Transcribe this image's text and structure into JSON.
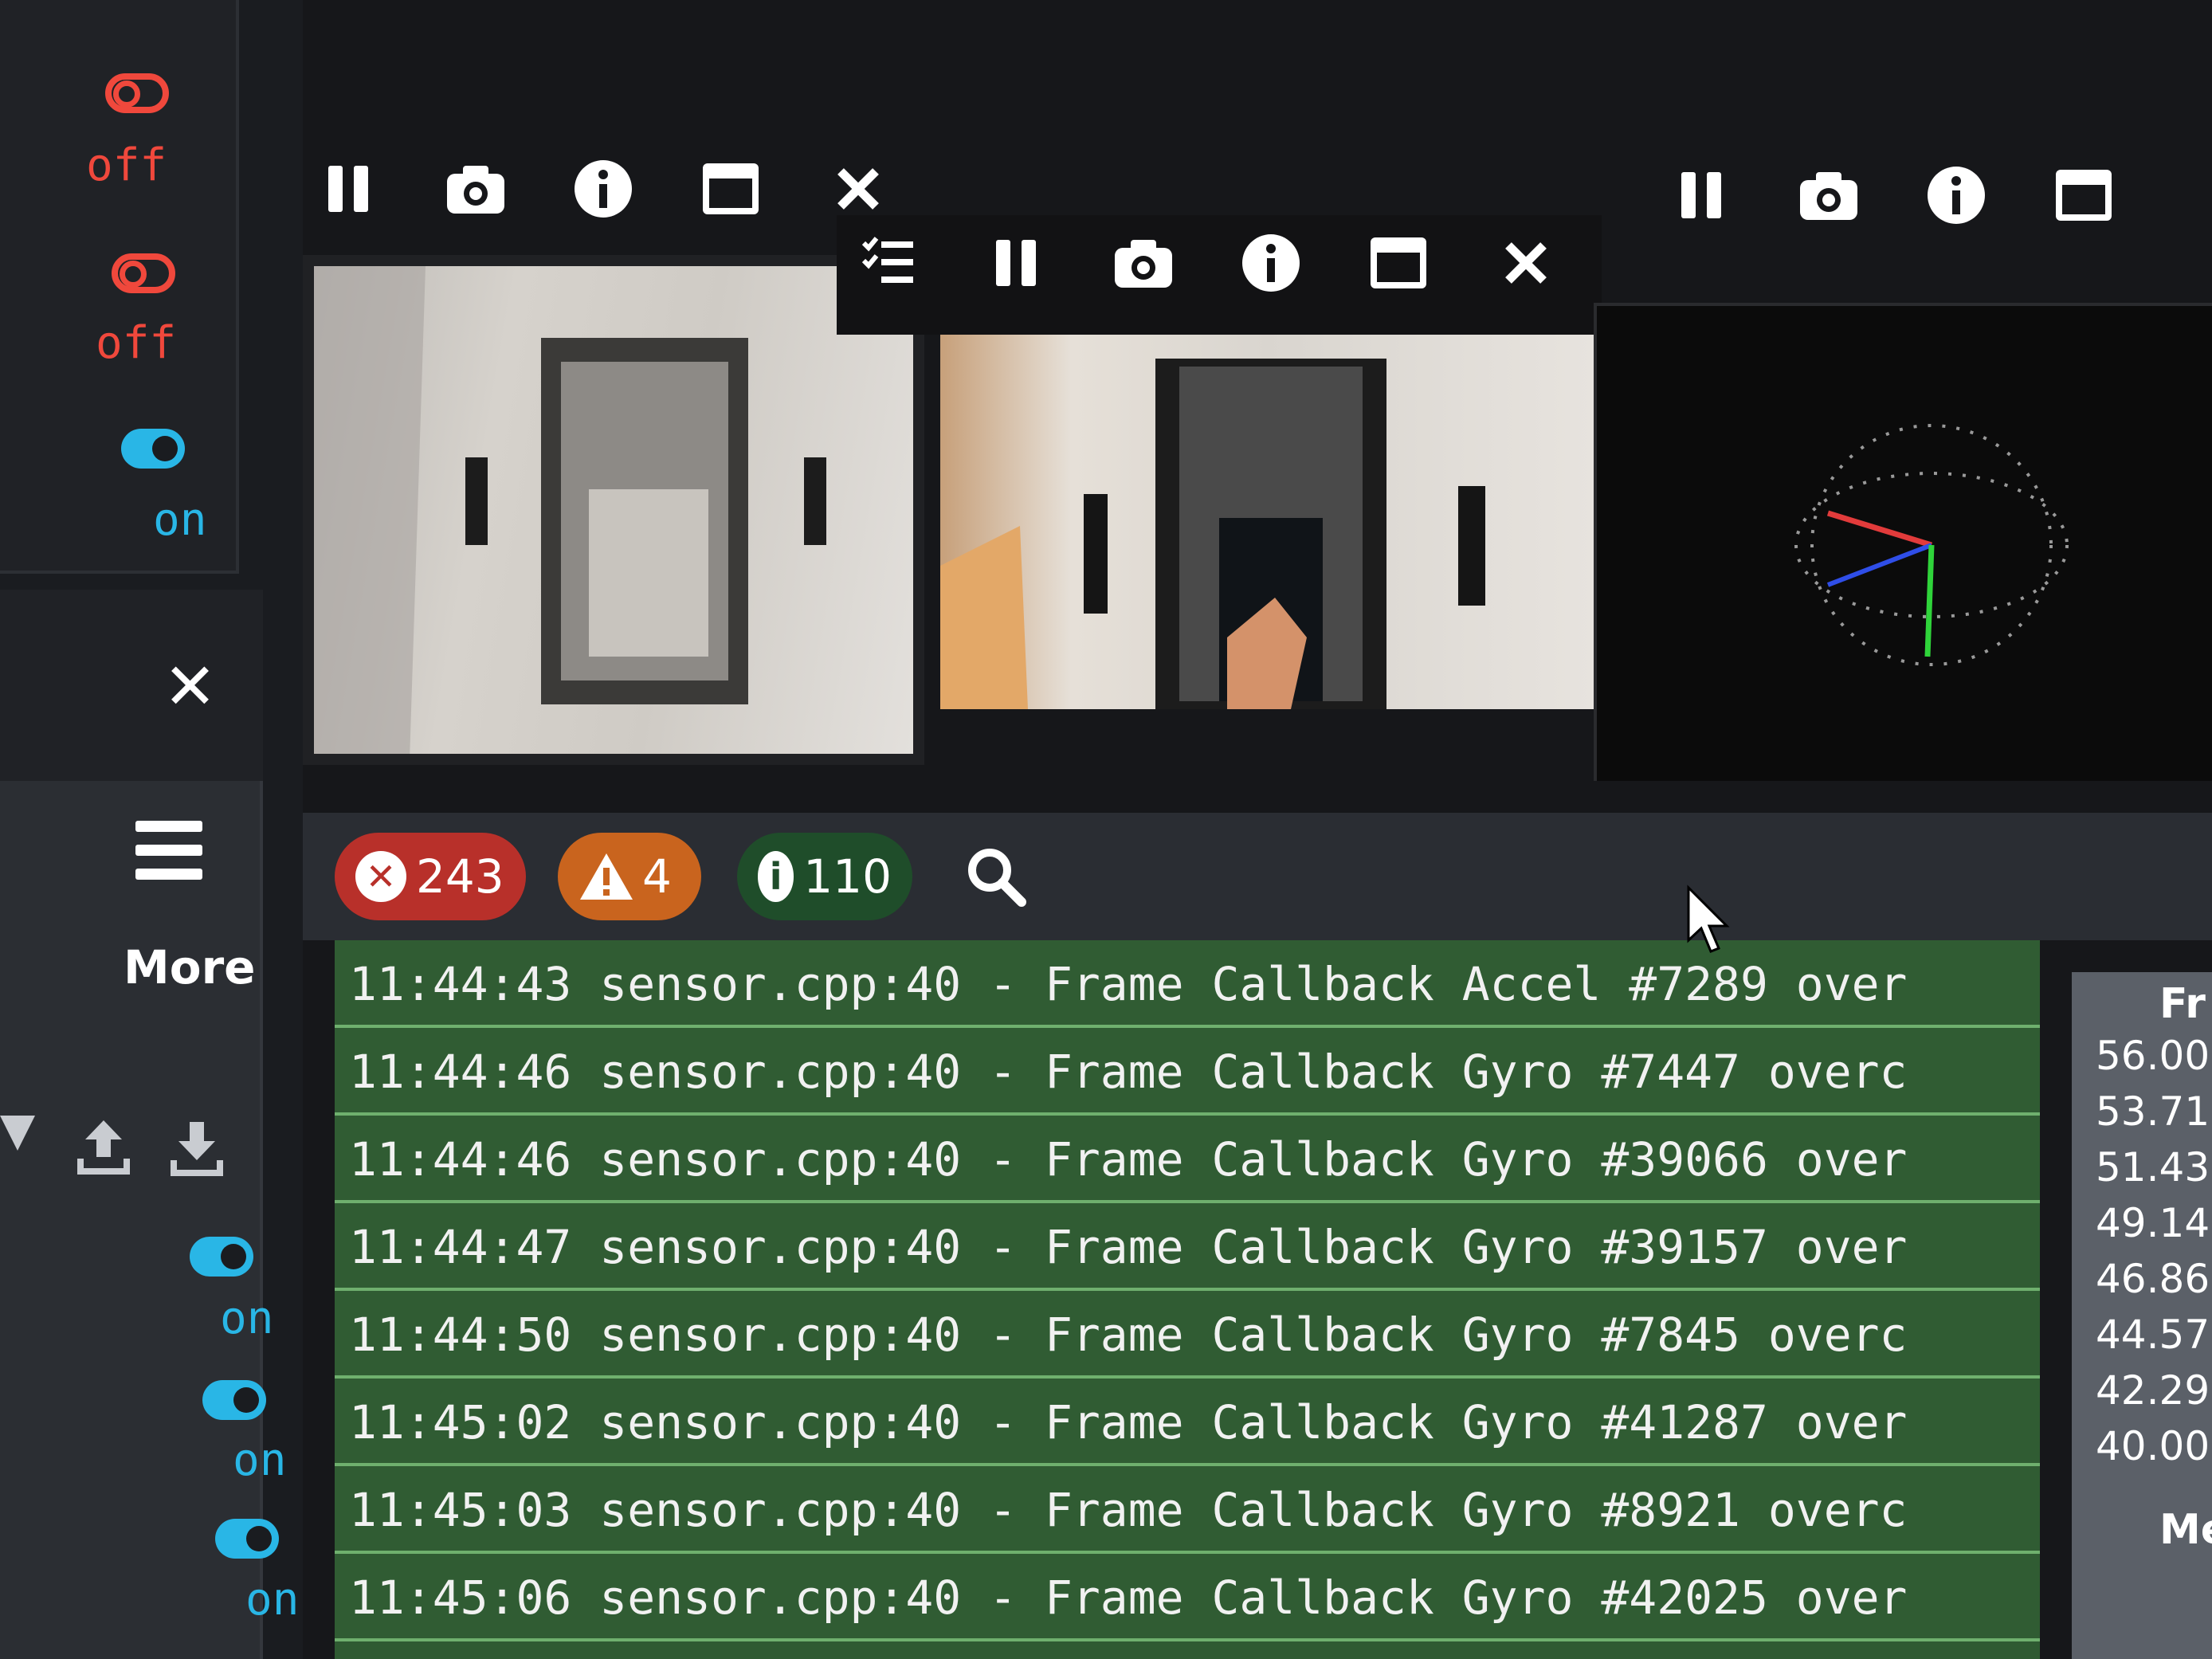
{
  "sidebar": {
    "toggles": [
      {
        "state": "off",
        "label": "off"
      },
      {
        "state": "off",
        "label": "off"
      },
      {
        "state": "on",
        "label": "on"
      }
    ],
    "close_label": "✕",
    "more_label": "More",
    "lower_toggles": [
      {
        "state": "on",
        "label": "on"
      },
      {
        "state": "on",
        "label": "on"
      },
      {
        "state": "on",
        "label": "on"
      }
    ]
  },
  "log": {
    "error_count": "243",
    "warning_count": "4",
    "info_count": "110",
    "rows": [
      "11:44:43 sensor.cpp:40 - Frame Callback Accel #7289 over",
      "11:44:46 sensor.cpp:40 - Frame Callback Gyro #7447 overc",
      "11:44:46 sensor.cpp:40 - Frame Callback Gyro #39066 over",
      "11:44:47 sensor.cpp:40 - Frame Callback Gyro #39157 over",
      "11:44:50 sensor.cpp:40 - Frame Callback Gyro #7845 overc",
      "11:45:02 sensor.cpp:40 - Frame Callback Gyro #41287 over",
      "11:45:03 sensor.cpp:40 - Frame Callback Gyro #8921 overc",
      "11:45:06 sensor.cpp:40 - Frame Callback Gyro #42025 over"
    ]
  },
  "stats": {
    "header": "Fr",
    "values": [
      "56.00",
      "53.71",
      "51.43",
      "49.14",
      "46.86",
      "44.57",
      "42.29",
      "40.00"
    ],
    "footer": "Me"
  },
  "colors": {
    "off_red": "#f0483c",
    "on_blue": "#29b6e6",
    "log_green": "#305c33",
    "error_badge": "#b8302a",
    "warning_badge": "#c9641e",
    "info_badge": "#1f4d2a"
  }
}
